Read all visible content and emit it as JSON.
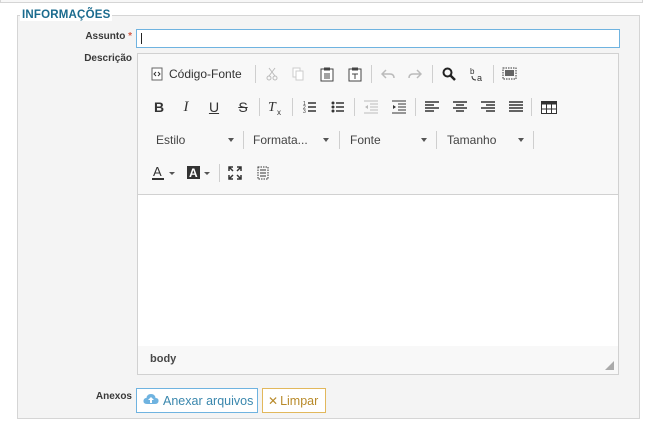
{
  "section": {
    "legend": "INFORMAÇÕES"
  },
  "assunto": {
    "label": "Assunto",
    "required_mark": "*",
    "value": ""
  },
  "descricao": {
    "label": "Descrição",
    "toolbar": {
      "source_label": "Código-Fonte",
      "combos": [
        {
          "label": "Estilo"
        },
        {
          "label": "Formata..."
        },
        {
          "label": "Fonte"
        },
        {
          "label": "Tamanho"
        }
      ]
    },
    "status_path": "body"
  },
  "anexos": {
    "label": "Anexos",
    "attach_label": "Anexar arquivos",
    "clear_label": "Limpar"
  },
  "colors": {
    "accent": "#6fb3e0",
    "legend": "#1a6b8e",
    "required": "#d15b47",
    "warning": "#e2b85c"
  }
}
